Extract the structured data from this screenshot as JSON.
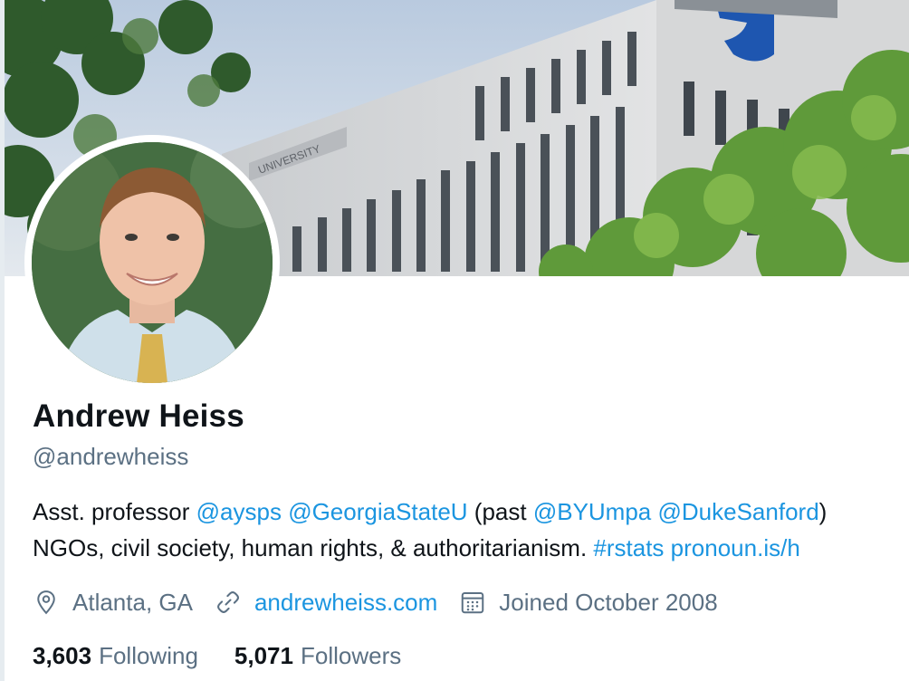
{
  "profile": {
    "name": "Andrew Heiss",
    "handle": "@andrewheiss",
    "banner_sign_text": "UNIVERSITY"
  },
  "bio": {
    "line1": {
      "t1": "Asst. professor ",
      "m1": "@aysps",
      "t2": " ",
      "m2": "@GeorgiaStateU",
      "t3": " (past ",
      "m3": "@BYUmpa",
      "t4": " ",
      "m4": "@DukeSanford",
      "t5": ")"
    },
    "line2": {
      "t1": "NGOs, civil society, human rights, & authoritarianism. ",
      "m1": "#rstats",
      "t2": " ",
      "m2": "pronoun.is/h"
    }
  },
  "meta": {
    "location": "Atlanta, GA",
    "location_icon": "location-pin-icon",
    "website": "andrewheiss.com",
    "website_icon": "link-icon",
    "joined": "Joined October 2008",
    "joined_icon": "calendar-icon"
  },
  "stats": {
    "following_count": "3,603",
    "following_label": "Following",
    "followers_count": "5,071",
    "followers_label": "Followers"
  },
  "colors": {
    "link": "#1b95e0",
    "secondary_text": "#5b7083",
    "primary_text": "#0f1419"
  }
}
